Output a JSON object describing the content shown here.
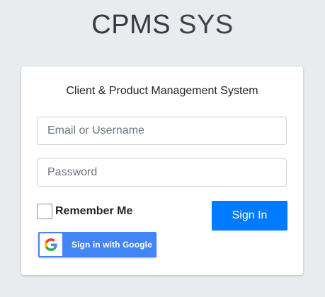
{
  "brand": {
    "bold": "CPMS",
    "light": "SYS"
  },
  "login": {
    "message": "Client & Product Management System",
    "email_placeholder": "Email or Username",
    "password_placeholder": "Password",
    "remember_label": "Remember Me",
    "remember_checked": false,
    "signin_label": "Sign In",
    "google_label": "Sign in with Google"
  },
  "colors": {
    "background": "#e9ecef",
    "primary": "#007bff",
    "google_blue": "#4285f4"
  },
  "icons": {
    "google": "google-g-icon"
  }
}
